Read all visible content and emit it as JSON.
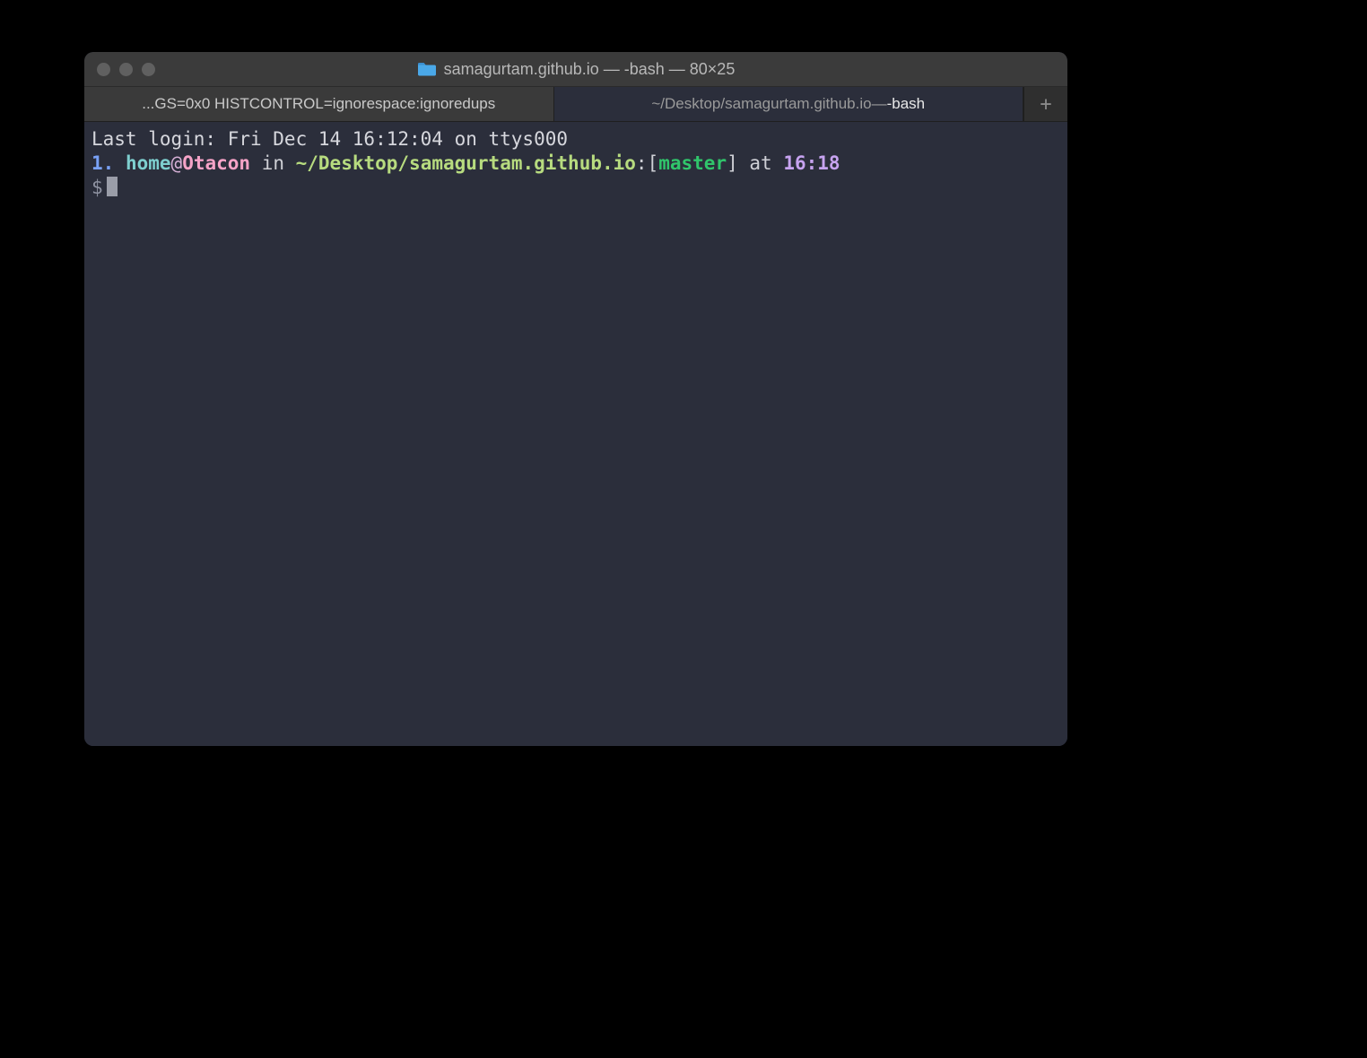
{
  "window": {
    "title": "samagurtam.github.io — -bash — 80×25"
  },
  "tabs": {
    "items": [
      {
        "label": "...GS=0x0 HISTCONTROL=ignorespace:ignoredups"
      },
      {
        "path": "~/Desktop/samagurtam.github.io",
        "sep": " — ",
        "proc": "-bash"
      }
    ],
    "newtab_glyph": "+"
  },
  "terminal": {
    "last_login": "Last login: Fri Dec 14 16:12:04 on ttys000",
    "prompt": {
      "num": "1.",
      "user": "home",
      "at": "@",
      "host": "Otacon",
      "in_word": " in ",
      "path": "~/Desktop/samagurtam.github.io",
      "colon": ":",
      "lbr": "[",
      "branch": "master",
      "rbr": "]",
      "at_word": " at ",
      "time": "16:18",
      "dollar": "$"
    }
  }
}
